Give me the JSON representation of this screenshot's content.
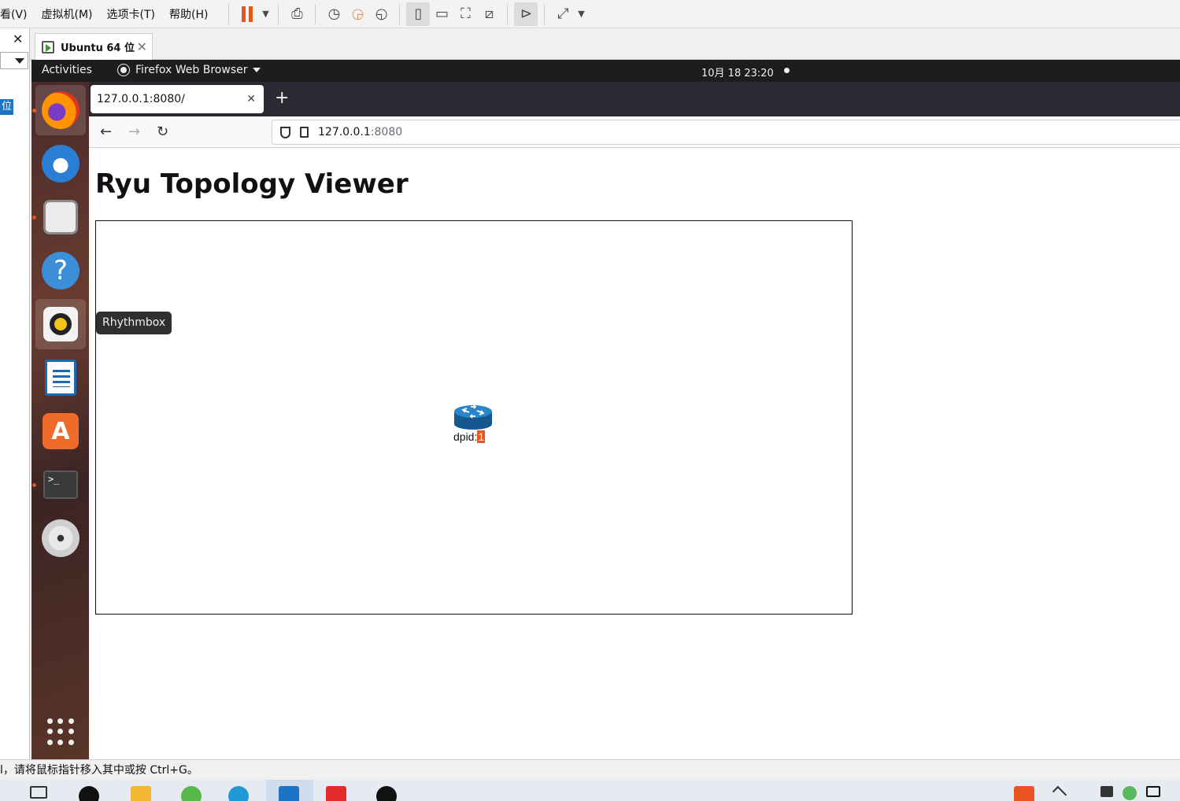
{
  "host": {
    "menus": [
      "看(V)",
      "虚拟机(M)",
      "选项卡(T)",
      "帮助(H)"
    ],
    "left_selected_char": "位",
    "vm_tab_title": "Ubuntu 64 位",
    "status_text": "l，请将鼠标指针移入其中或按 Ctrl+G。"
  },
  "gnome": {
    "activities": "Activities",
    "app_menu": "Firefox Web Browser",
    "clock": "10月 18  23:20"
  },
  "dock": {
    "items": [
      "firefox",
      "thunderbird",
      "files",
      "help",
      "rhythmbox",
      "libreoffice-writer",
      "ubuntu-software",
      "terminal",
      "dvd",
      "show-applications"
    ],
    "terminal_prompt": ">_",
    "help_glyph": "?",
    "store_glyph": "A",
    "tooltip": "Rhythmbox"
  },
  "firefox": {
    "tab_title": "127.0.0.1:8080/",
    "url_host": "127.0.0.1",
    "url_port": ":8080"
  },
  "page": {
    "title": "Ryu Topology Viewer",
    "node_label_prefix": "dpid:",
    "node_dpid": "1"
  },
  "colors": {
    "accent": "#e95420",
    "router": "#1b6ea8"
  }
}
